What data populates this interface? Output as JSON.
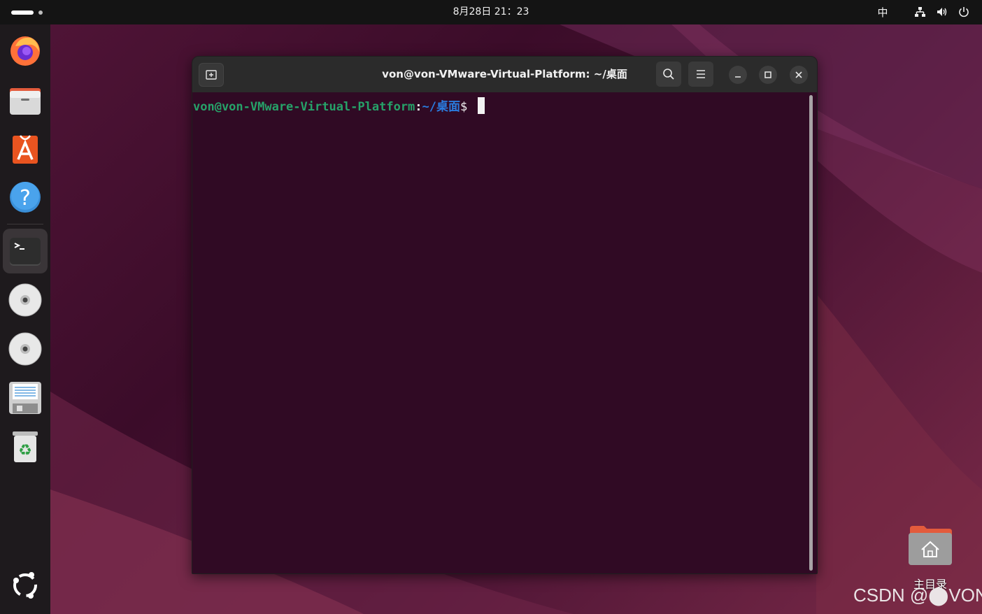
{
  "colors": {
    "topbar_bg": "#141414",
    "dock_bg": "#1e1a1d",
    "terminal_bg": "#300a24",
    "prompt_user": "#26a269",
    "prompt_path": "#2a7bde",
    "accent": "#e95420"
  },
  "topbar": {
    "clock": "8月28日  21：23",
    "input_method": "中",
    "icons": [
      "network-icon",
      "volume-icon",
      "power-icon"
    ]
  },
  "dock": {
    "items": [
      {
        "icon": "firefox-icon"
      },
      {
        "icon": "files-icon"
      },
      {
        "icon": "app-center-icon"
      },
      {
        "icon": "help-icon"
      },
      {
        "icon": "terminal-icon",
        "active": true
      },
      {
        "icon": "cd-drive-icon"
      },
      {
        "icon": "cd-drive-icon"
      },
      {
        "icon": "floppy-disk-icon"
      },
      {
        "icon": "trash-icon"
      },
      {
        "icon": "show-apps-icon"
      }
    ]
  },
  "terminal": {
    "title": "von@von-VMware-Virtual-Platform: ~/桌面",
    "prompt_user": "von@von-VMware-Virtual-Platform",
    "prompt_colon": ":",
    "prompt_path": "~/桌面",
    "prompt_dollar": "$"
  },
  "desktop": {
    "home_label": "主目录",
    "watermark": "CSDN @⬤VON"
  }
}
